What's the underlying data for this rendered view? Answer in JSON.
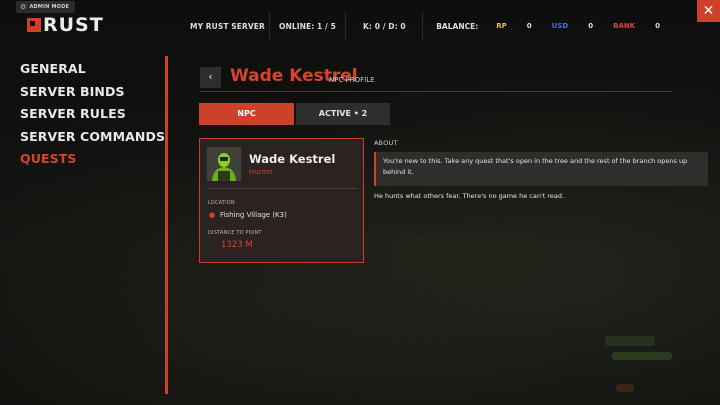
{
  "admin": {
    "label": "ADMIN MODE",
    "icon": "gear-icon"
  },
  "logo": {
    "text": "RUST"
  },
  "topbar": {
    "server_name": "MY RUST SERVER",
    "online": "ONLINE: 1 / 5",
    "kd": "K: 0 / D: 0",
    "balance_label": "BALANCE:",
    "currencies": [
      {
        "name": "RP",
        "value": "0",
        "color": "#e5c23a"
      },
      {
        "name": "USD",
        "value": "0",
        "color": "#3f6fe6"
      },
      {
        "name": "BANK",
        "value": "0",
        "color": "#e0413a"
      }
    ]
  },
  "close": {
    "label": "✕"
  },
  "nav": {
    "items": [
      {
        "label": "GENERAL",
        "active": false
      },
      {
        "label": "SERVER BINDS",
        "active": false
      },
      {
        "label": "SERVER RULES",
        "active": false
      },
      {
        "label": "SERVER COMMANDS",
        "active": false
      },
      {
        "label": "QUESTS",
        "active": true
      }
    ]
  },
  "header": {
    "back_label": "‹",
    "title": "Wade Kestrel",
    "subtitle": "NPC PROFILE"
  },
  "tabs": [
    {
      "label": "NPC",
      "active": true
    },
    {
      "label": "ACTIVE • 2",
      "active": false
    }
  ],
  "card": {
    "name": "Wade Kestrel",
    "role": "Hunter",
    "location_label": "LOCATION",
    "location": "Fishing Village (K3)",
    "distance_label": "DISTANCE TO POINT",
    "distance": "1323 M"
  },
  "about": {
    "label": "ABOUT",
    "hint": "You're new to this. Take any quest that's open in the tree and the rest of the branch opens up behind it.",
    "text": "He hunts what others fear. There's no game he can't read."
  },
  "colors": {
    "accent": "#cd412b",
    "panel": "#2e2f2d"
  }
}
